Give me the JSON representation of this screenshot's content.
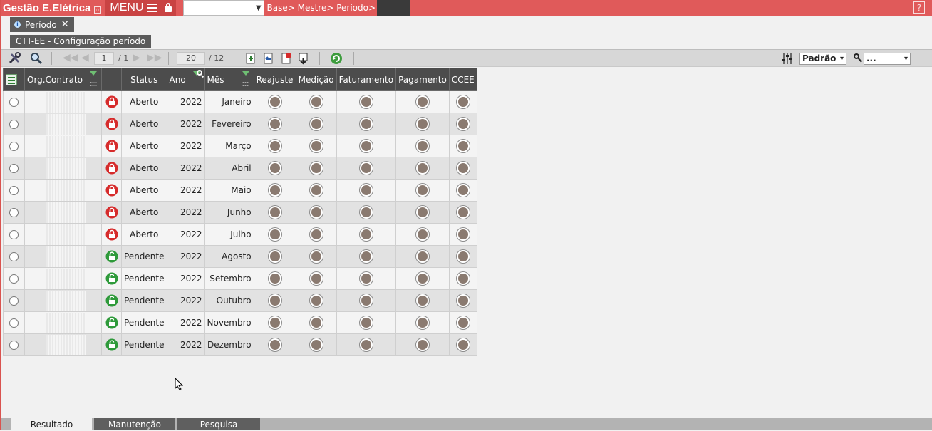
{
  "app": {
    "title": "Gestão E.Elétrica",
    "menu_label": "MENU",
    "breadcrumb": "Base> Mestre> Período>",
    "help_label": "?"
  },
  "tab": {
    "label": "Período",
    "close": "✕",
    "info": "i"
  },
  "subtitle": "CTT-EE - Configuração período",
  "toolbar": {
    "page_current": "1",
    "page_total": "/ 1",
    "rows_per_page": "20",
    "rows_total": "/ 12",
    "layout_select": "Padrão",
    "filter_select": "...",
    "dropdown_arrow": "▾",
    "nav_first": "◀◀",
    "nav_prev": "◀",
    "nav_next": "▶",
    "nav_last": "▶▶"
  },
  "grid": {
    "columns": {
      "org": "Org.Contrato",
      "status": "Status",
      "ano": "Ano",
      "mes": "Mês",
      "reajuste": "Reajuste",
      "medicao": "Medição",
      "faturamento": "Faturamento",
      "pagamento": "Pagamento",
      "ccee": "CCEE"
    },
    "rows": [
      {
        "status": "Aberto",
        "ano": "2022",
        "mes": "Janeiro",
        "locked": true
      },
      {
        "status": "Aberto",
        "ano": "2022",
        "mes": "Fevereiro",
        "locked": true
      },
      {
        "status": "Aberto",
        "ano": "2022",
        "mes": "Março",
        "locked": true
      },
      {
        "status": "Aberto",
        "ano": "2022",
        "mes": "Abril",
        "locked": true
      },
      {
        "status": "Aberto",
        "ano": "2022",
        "mes": "Maio",
        "locked": true
      },
      {
        "status": "Aberto",
        "ano": "2022",
        "mes": "Junho",
        "locked": true
      },
      {
        "status": "Aberto",
        "ano": "2022",
        "mes": "Julho",
        "locked": true
      },
      {
        "status": "Pendente",
        "ano": "2022",
        "mes": "Agosto",
        "locked": false
      },
      {
        "status": "Pendente",
        "ano": "2022",
        "mes": "Setembro",
        "locked": false
      },
      {
        "status": "Pendente",
        "ano": "2022",
        "mes": "Outubro",
        "locked": false
      },
      {
        "status": "Pendente",
        "ano": "2022",
        "mes": "Novembro",
        "locked": false
      },
      {
        "status": "Pendente",
        "ano": "2022",
        "mes": "Dezembro",
        "locked": false
      }
    ]
  },
  "bottom_tabs": [
    "Resultado",
    "Manutenção",
    "Pesquisa"
  ],
  "colors": {
    "topbar": "#e05a5a",
    "header": "#4c4c4c",
    "locked_red": "#d62b2b",
    "unlocked_green": "#2e9a3a"
  }
}
